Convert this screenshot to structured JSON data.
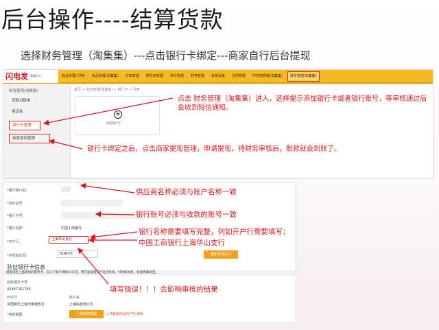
{
  "slide": {
    "title": "后台操作----结算货款",
    "subtitle": "选择财务管理（淘集集）---点击银行卡绑定---商家自行后台提现"
  },
  "top_screenshot": {
    "logo": "闪电发",
    "logo_sub": "管理后台",
    "nav": [
      "商品管理(闪电)",
      "商品管理(淘集集)",
      "订单管理",
      "供应商管理",
      "评价管理",
      "财务管理",
      "系统设置",
      "合同管理",
      "供应商管理(淘集集)",
      "财务管理(淘集集)"
    ],
    "sidebar_head": "财务管理(淘集集)",
    "sidebar_items": [
      "货款对账单",
      "保证金",
      "银行卡管理",
      "商家提现管理"
    ],
    "breadcrumb": "首页 > 财务管理(淘集集) > 银行卡 > 列表",
    "add_card_label": "添加银行卡",
    "note_enter": "点击 财务管理（淘集集）进入，选择提示添加银行卡或者银行账号，等审核通过后会收到短信通知。",
    "note_withdraw": "银行卡绑定之后，点击商家提现管理，申请提现，待财务审核后，账款就会到账了。"
  },
  "bottom_screenshot": {
    "labels": [
      "*银行账户名：",
      "*身份证号：",
      "*银行卡号：",
      "*银行名称：",
      "*开户行：",
      "*手机验证码："
    ],
    "bank_name": "中国工商银行",
    "branch": "上海华山支行",
    "sms_code": "814055",
    "sms_button": "重新获取(12)",
    "verify_title": "验证银行卡信息",
    "verify_hint": "请查询您上面添加的银行卡，向以下账户转帐0.01元。用于验证银行卡是否有效。打款如失败，将会原路退回。",
    "receive_label": "收款银行卡号",
    "receive_number": "43387361765",
    "branch_label": "开户行",
    "branch_value": "中国银行上海市黄浦支行",
    "account_label": "账户名",
    "account_value": "上海好家佳公司",
    "screenshot_label": "*转账截图：",
    "upload_button": "上传财务截图",
    "upload_tip": "上传截图后同步至平台审核"
  },
  "annotations": {
    "name_match": "供应商名称必须与账户名称一致",
    "account_match": "银行账号必须与收款的账号一致",
    "bank_full": "银行名称需要填写完整，列如开户行需要填写：中国工商银行上海华山支行",
    "error_warning": "填写错误！！！会影响审核的结果"
  },
  "colors": {
    "nav_bg": "#f6ba24",
    "annotation_red": "#d8161c",
    "button_orange": "#f2a21a"
  }
}
